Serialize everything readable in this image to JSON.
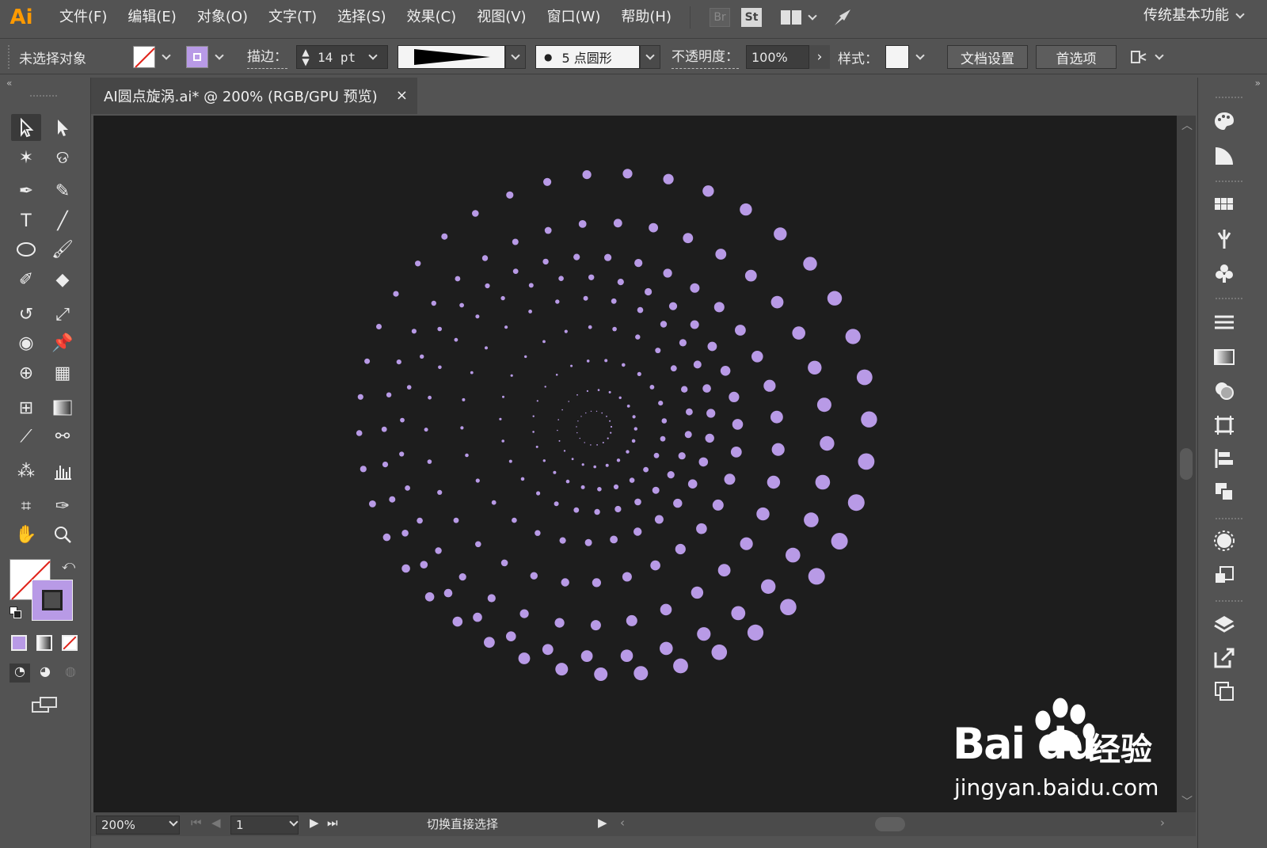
{
  "app": {
    "logo": "Ai"
  },
  "menu": {
    "items": [
      "文件(F)",
      "编辑(E)",
      "对象(O)",
      "文字(T)",
      "选择(S)",
      "效果(C)",
      "视图(V)",
      "窗口(W)",
      "帮助(H)"
    ],
    "bridge_label": "Br",
    "stock_label": "St",
    "workspace": "传统基本功能"
  },
  "control": {
    "selection_status": "未选择对象",
    "stroke_label": "描边：",
    "stroke_weight": "14 pt",
    "brush_label": "5 点圆形",
    "opacity_label": "不透明度：",
    "opacity_value": "100%",
    "style_label": "样式：",
    "doc_setup_button": "文档设置",
    "preferences_button": "首选项"
  },
  "document": {
    "tab_title": "AI圆点旋涡.ai* @ 200% (RGB/GPU 预览)",
    "close_glyph": "×",
    "dot_color": "#b89ae6",
    "canvas_color": "#1d1d1d"
  },
  "status": {
    "zoom": "200%",
    "page": "1",
    "tool_hint": "切换直接选择"
  },
  "watermark": {
    "logo_text": "Bai du",
    "logo_cn": "经验",
    "url": "jingyan.baidu.com"
  },
  "colors": {
    "ui_bg": "#535353",
    "accent": "#b89ae6",
    "ai_orange": "#ff9a00"
  }
}
